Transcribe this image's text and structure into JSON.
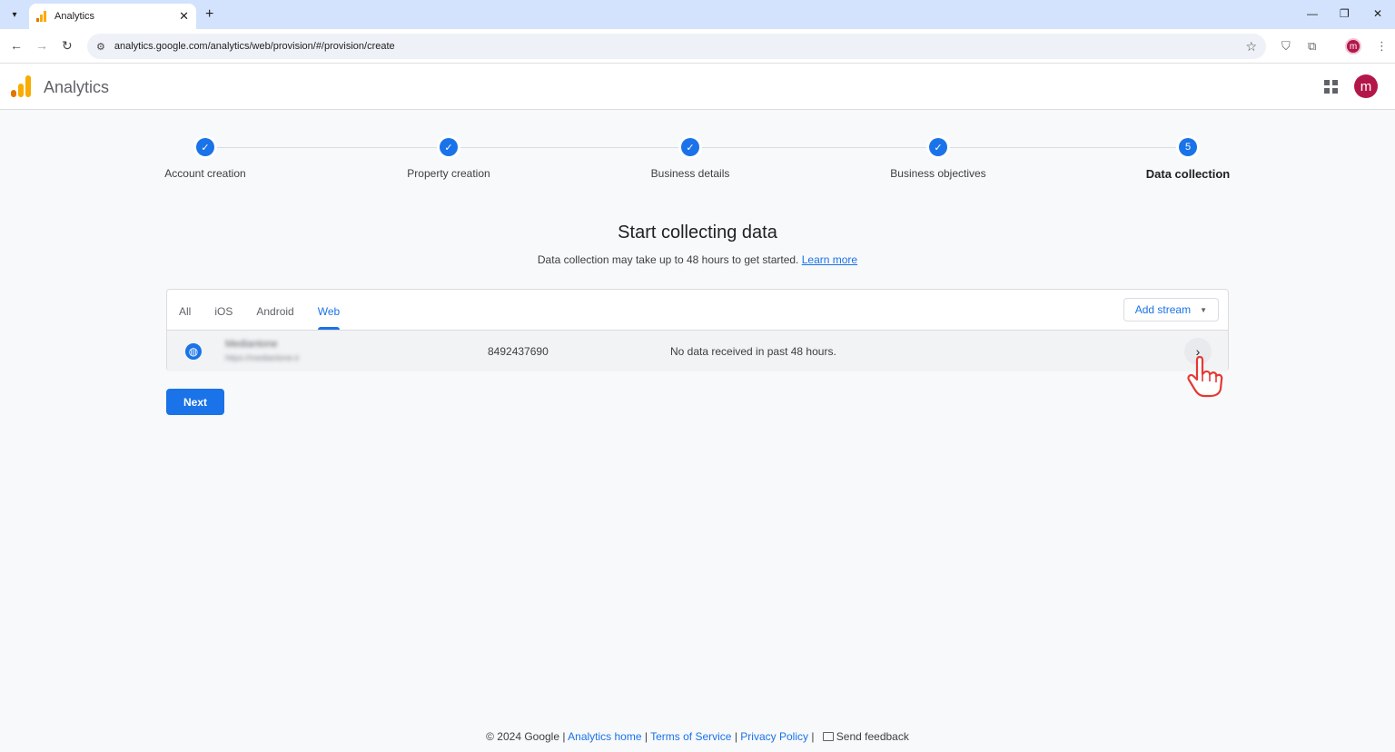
{
  "browser": {
    "tab_title": "Analytics",
    "new_tab": "+",
    "url": "analytics.google.com/analytics/web/provision/#/provision/create",
    "profile_initial": "m"
  },
  "app": {
    "title": "Analytics",
    "avatar_initial": "m"
  },
  "stepper": {
    "steps": [
      {
        "label": "Account creation",
        "state": "done",
        "marker": "✓"
      },
      {
        "label": "Property creation",
        "state": "done",
        "marker": "✓"
      },
      {
        "label": "Business details",
        "state": "done",
        "marker": "✓"
      },
      {
        "label": "Business objectives",
        "state": "done",
        "marker": "✓"
      },
      {
        "label": "Data collection",
        "state": "active",
        "marker": "5"
      }
    ]
  },
  "main": {
    "heading": "Start collecting data",
    "subtext": "Data collection may take up to 48 hours to get started.",
    "learn_more": "Learn more"
  },
  "streams": {
    "tabs": [
      "All",
      "iOS",
      "Android",
      "Web"
    ],
    "active_tab": "Web",
    "add_stream_label": "Add stream",
    "rows": [
      {
        "name": "Mediantone",
        "url": "https://mediantone.ir",
        "id": "8492437690",
        "status": "No data received in past 48 hours."
      }
    ]
  },
  "actions": {
    "next_label": "Next"
  },
  "footer": {
    "copyright": "© 2024 Google |",
    "analytics_home": "Analytics home",
    "terms": "Terms of Service",
    "privacy": "Privacy Policy",
    "send_feedback": "Send feedback",
    "sep": "|"
  },
  "colors": {
    "accent": "#1a73e8",
    "logo_orange": "#f9ab00",
    "logo_dark_orange": "#e37400",
    "avatar": "#b3174a",
    "cursor_red": "#e53935"
  },
  "icons": {
    "back": "arrow-left-icon",
    "forward": "arrow-right-icon",
    "reload": "reload-icon",
    "apps": "apps-grid-icon",
    "globe": "globe-icon",
    "chevron": "chevron-right-icon"
  }
}
